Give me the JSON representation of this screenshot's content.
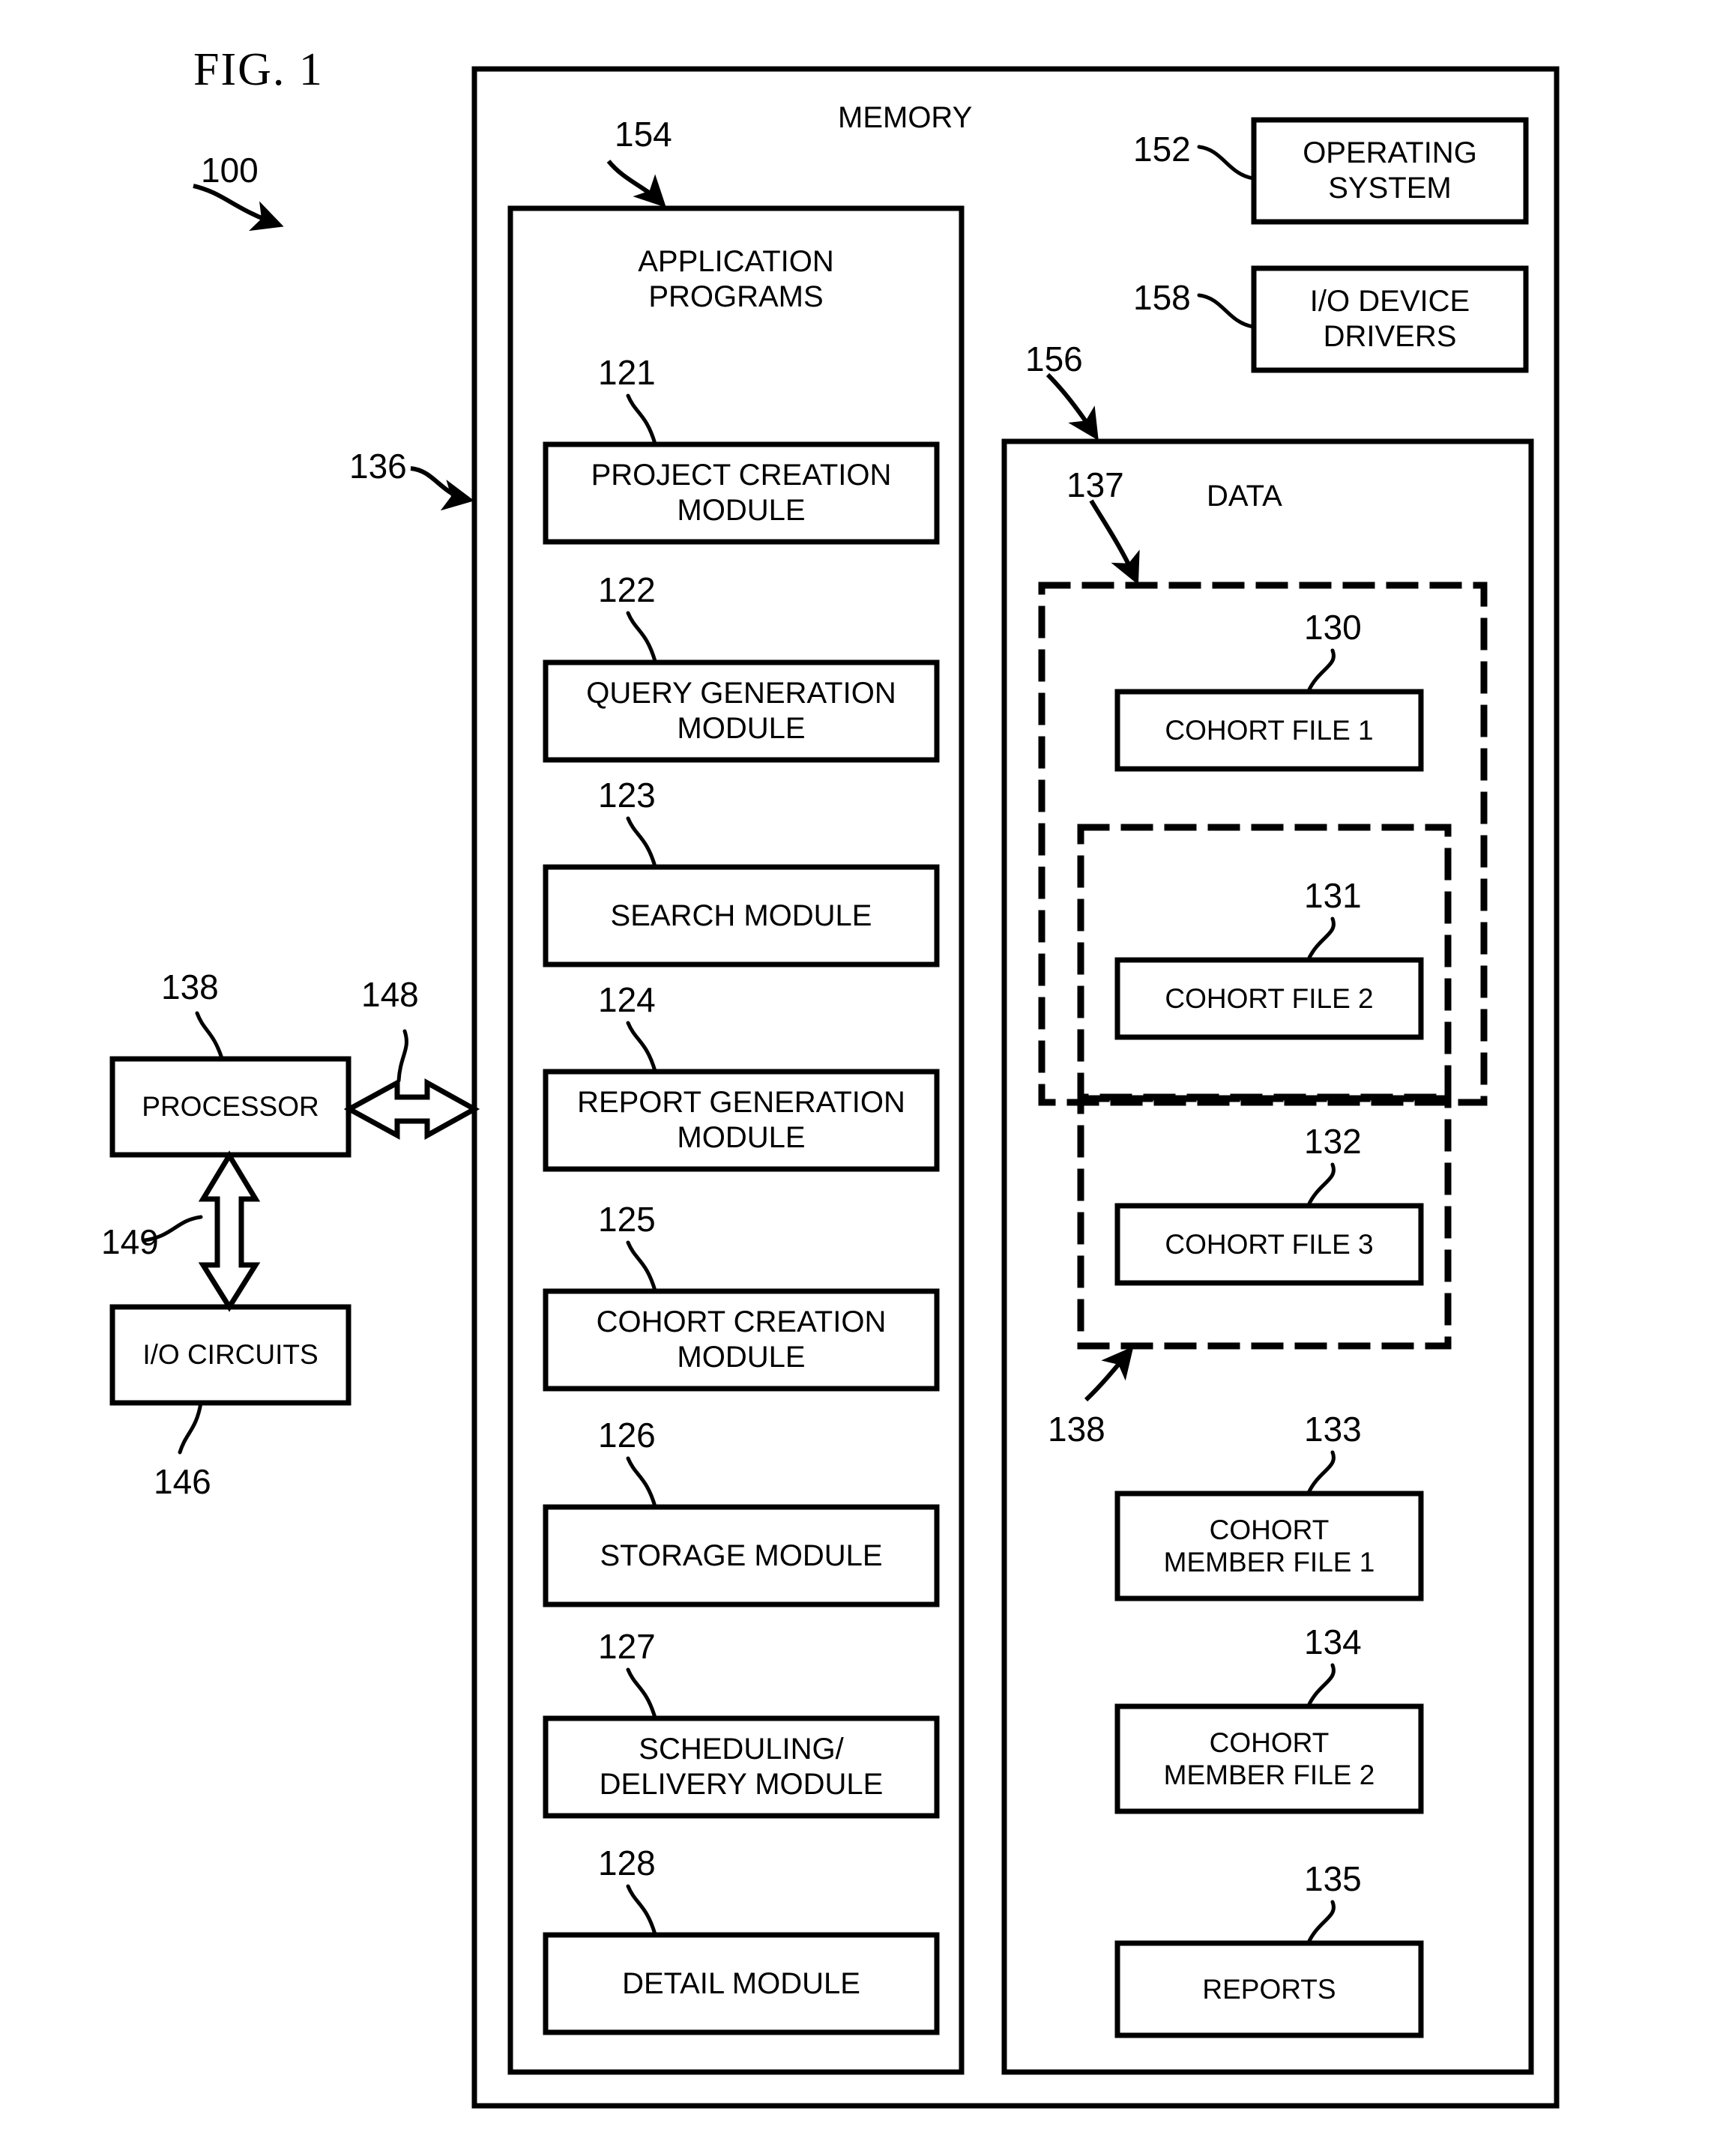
{
  "figure": {
    "title": "FIG. 1",
    "system_ref": "100"
  },
  "colors": {
    "stroke": "#000000",
    "background": "#ffffff"
  },
  "frames": {
    "memory": {
      "label": "MEMORY",
      "ref": "136"
    },
    "application_programs": {
      "label": "APPLICATION\nPROGRAMS",
      "ref": "154"
    },
    "data": {
      "label": "DATA",
      "ref": "156"
    },
    "cohort_group_outer": {
      "ref": "137"
    },
    "cohort_group_inner": {
      "ref": "138"
    }
  },
  "external_boxes": [
    {
      "ref": "152",
      "label": "OPERATING\nSYSTEM",
      "name": "operating-system-box"
    },
    {
      "ref": "158",
      "label": "I/O DEVICE\nDRIVERS",
      "name": "io-device-drivers-box"
    }
  ],
  "hardware_boxes": [
    {
      "ref": "138",
      "label": "PROCESSOR",
      "name": "processor-box"
    },
    {
      "ref": "146",
      "label": "I/O CIRCUITS",
      "name": "io-circuits-box"
    }
  ],
  "connectors": [
    {
      "ref": "148",
      "name": "processor-memory-bus"
    },
    {
      "ref": "149",
      "name": "processor-io-bus"
    }
  ],
  "modules": [
    {
      "ref": "121",
      "label": "PROJECT CREATION\nMODULE",
      "name": "project-creation-module"
    },
    {
      "ref": "122",
      "label": "QUERY GENERATION\nMODULE",
      "name": "query-generation-module"
    },
    {
      "ref": "123",
      "label": "SEARCH MODULE",
      "name": "search-module"
    },
    {
      "ref": "124",
      "label": "REPORT GENERATION\nMODULE",
      "name": "report-generation-module"
    },
    {
      "ref": "125",
      "label": "COHORT CREATION\nMODULE",
      "name": "cohort-creation-module"
    },
    {
      "ref": "126",
      "label": "STORAGE MODULE",
      "name": "storage-module"
    },
    {
      "ref": "127",
      "label": "SCHEDULING/\nDELIVERY MODULE",
      "name": "scheduling-delivery-module"
    },
    {
      "ref": "128",
      "label": "DETAIL  MODULE",
      "name": "detail-module"
    }
  ],
  "data_boxes": [
    {
      "ref": "130",
      "label": "COHORT FILE 1",
      "name": "cohort-file-1-box"
    },
    {
      "ref": "131",
      "label": "COHORT FILE 2",
      "name": "cohort-file-2-box"
    },
    {
      "ref": "132",
      "label": "COHORT FILE 3",
      "name": "cohort-file-3-box"
    },
    {
      "ref": "133",
      "label": "COHORT\nMEMBER FILE 1",
      "name": "cohort-member-file-1-box"
    },
    {
      "ref": "134",
      "label": "COHORT\nMEMBER FILE 2",
      "name": "cohort-member-file-2-box"
    },
    {
      "ref": "135",
      "label": "REPORTS",
      "name": "reports-box"
    }
  ]
}
